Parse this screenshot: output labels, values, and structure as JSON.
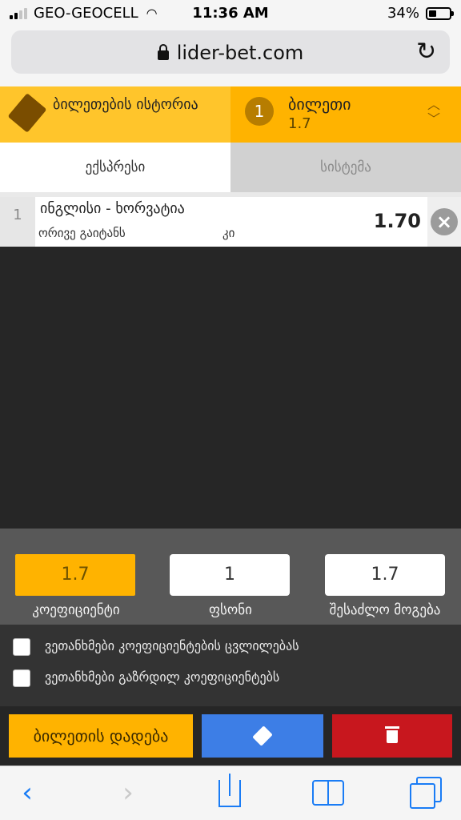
{
  "status_bar": {
    "carrier": "GEO-GEOCELL",
    "time": "11:36 AM",
    "battery": "34%"
  },
  "browser": {
    "url": "lider-bet.com"
  },
  "header": {
    "history_label": "ბილეთების ისტორია",
    "bet_count": "1",
    "bet_title": "ბილეთი",
    "bet_odds": "1.7"
  },
  "tabs": {
    "express": "ექსპრესი",
    "system": "სისტემა"
  },
  "selection": {
    "index": "1",
    "match": "ინგლისი - ხორვატია",
    "market": "ორივე გაიტანს",
    "pick": "კი",
    "odds": "1.70"
  },
  "inputs": {
    "coefficient_value": "1.7",
    "coefficient_label": "კოეფიციენტი",
    "stake_value": "1",
    "stake_label": "ფსონი",
    "win_value": "1.7",
    "win_label": "შესაძლო მოგება"
  },
  "options": {
    "accept_changes": "ვეთანხმები კოეფიციენტების ცვლილებას",
    "accept_increase": "ვეთანხმები გაზრდილ კოეფიციენტებს"
  },
  "actions": {
    "place_bet": "ბილეთის დადება"
  },
  "colors": {
    "accent": "#ffb300",
    "ticket_button": "#3d7ee6",
    "delete_button": "#c8171e"
  }
}
